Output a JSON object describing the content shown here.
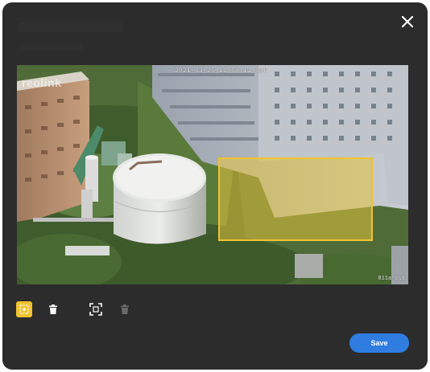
{
  "dialog": {
    "close_icon": "close-icon"
  },
  "camera": {
    "timestamp": "2021-03-25 11:58:14 Sat",
    "watermark": "reolink",
    "label": "811a-cut"
  },
  "roi": {
    "fill_color": "#e6c43c",
    "border_color": "#f2c230"
  },
  "toolbar": {
    "tools": [
      {
        "icon": "draw-area-icon",
        "active": true
      },
      {
        "icon": "trash-icon",
        "active": false
      },
      {
        "icon": "fullscreen-icon",
        "active": false
      },
      {
        "icon": "trash-icon",
        "disabled": true
      }
    ]
  },
  "actions": {
    "save_label": "Save",
    "save_color": "#2f7de1"
  }
}
